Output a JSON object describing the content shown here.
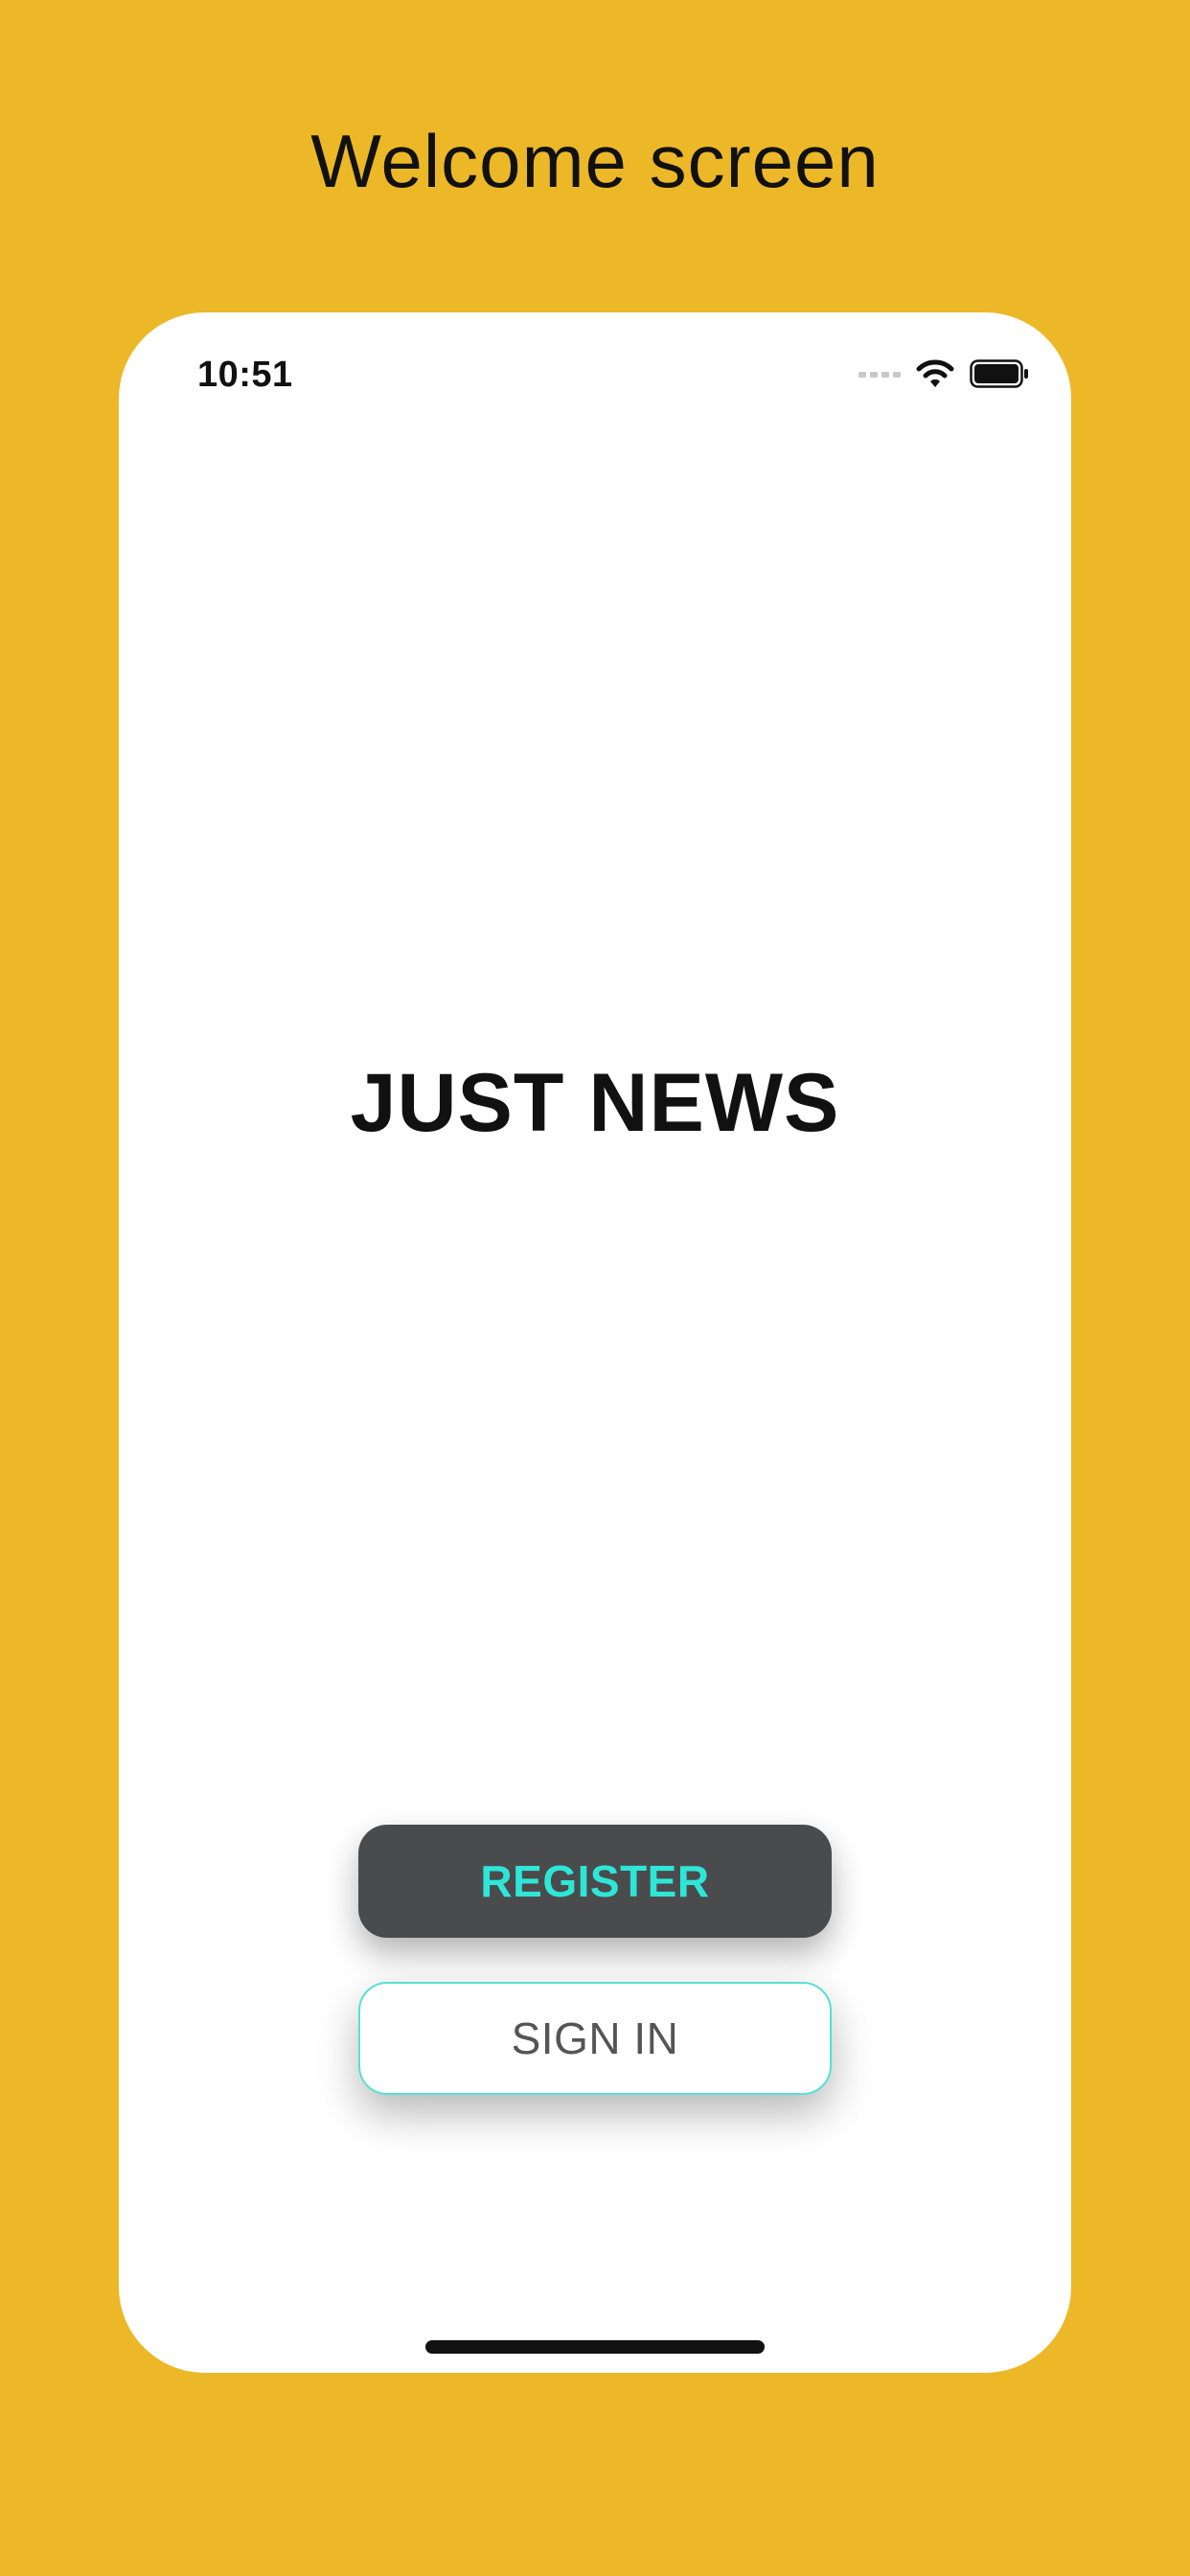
{
  "heading": "Welcome screen",
  "status_bar": {
    "time": "10:51",
    "icons": [
      "cellular-signal-icon",
      "wifi-icon",
      "battery-icon"
    ]
  },
  "app": {
    "title": "JUST NEWS"
  },
  "buttons": {
    "register_label": "REGISTER",
    "signin_label": "SIGN IN"
  },
  "colors": {
    "background": "#ecb827",
    "register_bg": "#4a4b4d",
    "accent": "#2ee6d7"
  }
}
